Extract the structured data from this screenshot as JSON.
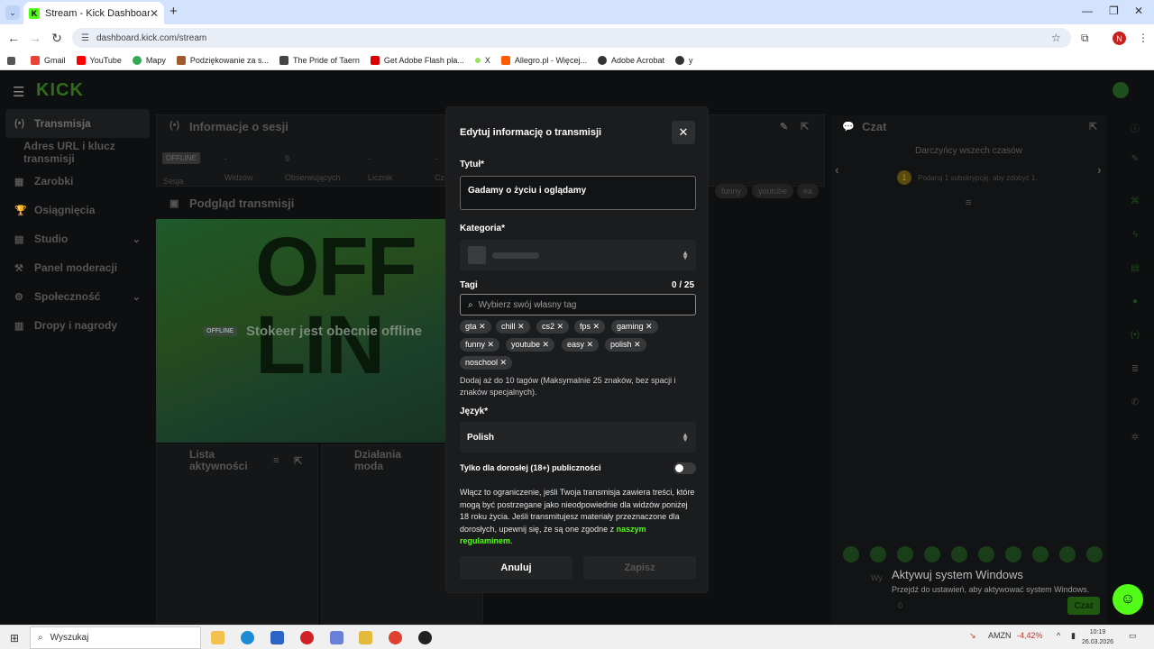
{
  "browser": {
    "tab_title": "Stream - Kick Dashboard",
    "address": "dashboard.kick.com/stream",
    "bookmarks": [
      "Gmail",
      "YouTube",
      "Mapy",
      "Podziękowanie za s...",
      "The Pride of Taern",
      "Get Adobe Flash pla...",
      "X",
      "Allegro.pl - Więcej...",
      "Adobe Acrobat",
      "y"
    ],
    "profile_initial": "N"
  },
  "kick": {
    "logo": "KICK",
    "sidebar": [
      {
        "label": "Transmisja",
        "icon": "(•)"
      },
      {
        "label": "Adres URL i klucz transmisji",
        "icon": ""
      },
      {
        "label": "Zarobki",
        "icon": "▦"
      },
      {
        "label": "Osiągnięcia",
        "icon": "🏆"
      },
      {
        "label": "Studio",
        "icon": "▤"
      },
      {
        "label": "Panel moderacji",
        "icon": "⚒"
      },
      {
        "label": "Społeczność",
        "icon": "⚙"
      },
      {
        "label": "Dropy i nagrody",
        "icon": "▥"
      }
    ],
    "session_title": "Informacje o sesji",
    "offline_badge": "OFFLINE",
    "session_label": "Sesja",
    "stats": [
      {
        "value": "-",
        "label": "Widzów"
      },
      {
        "value": "9",
        "label": "Obserwujących"
      },
      {
        "value": "-",
        "label": "Licznik"
      },
      {
        "value": "-",
        "label": "Cz"
      }
    ],
    "preview_title": "Podgląd transmisji",
    "offline_badge_small": "OFFLINE",
    "offline_message": "Stokeer jest obecnie offline",
    "bg_tags": [
      "funny",
      "youtube",
      "ea"
    ],
    "activity_title": "Lista aktywności",
    "mod_title": "Działania moda",
    "chat_title": "Czat",
    "chat_gifters": "Darczyńcy wszech czasów",
    "chat_gift_hint": "Podaruj 1 subskrypcję, aby zdobyć 1.",
    "chat_input_placeholder": "Wy",
    "chat_button": "Czat",
    "chat_count": "0",
    "windows_activate_title": "Aktywuj system Windows",
    "windows_activate_sub": "Przejdź do ustawień, aby aktywować system Windows."
  },
  "modal": {
    "title": "Edytuj informację o transmisji",
    "title_label": "Tytuł*",
    "title_value": "Gadamy o życiu i oglądamy",
    "category_label": "Kategoria*",
    "tags_label": "Tagi",
    "tags_count": "0 / 25",
    "tags_placeholder": "Wybierz swój własny tag",
    "tags": [
      "gta",
      "chill",
      "cs2",
      "fps",
      "gaming",
      "funny",
      "youtube",
      "easy",
      "polish",
      "noschool"
    ],
    "tags_hint": "Dodaj aż do 10 tagów (Maksymalnie 25 znaków, bez spacji i znaków specjalnych).",
    "language_label": "Język*",
    "language_value": "Polish",
    "adult_label": "Tylko dla dorosłej (18+) publiczności",
    "adult_enabled": false,
    "adult_desc": "Włącz to ograniczenie, jeśli Twoja transmisja zawiera treści, które mogą być postrzegane jako nieodpowiednie dla widzów poniżej 18 roku życia. Jeśli transmitujesz materiały przeznaczone dla dorosłych, upewnij się, że są one zgodne z",
    "adult_link": "naszym regulaminem",
    "adult_end": ".",
    "cancel_label": "Anuluj",
    "save_label": "Zapisz"
  },
  "taskbar": {
    "search_placeholder": "Wyszukaj",
    "stock_ticker": "AMZN",
    "stock_change": "-4,42%",
    "time": "10:19",
    "date": "26.03.2026"
  },
  "colors": {
    "accent": "#53fc18",
    "modal_bg": "#1b1c1e",
    "page_bg": "#0e0f10"
  }
}
